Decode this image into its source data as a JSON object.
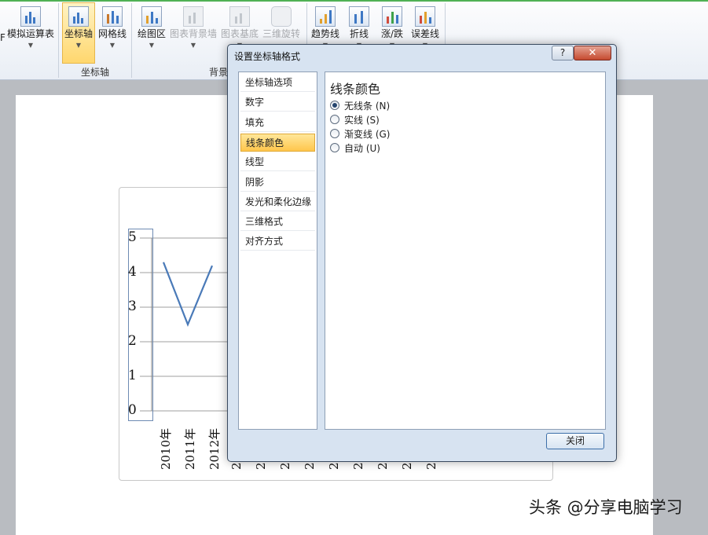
{
  "ribbon": {
    "buttons": [
      {
        "label": "模拟运算表",
        "dim": false
      },
      {
        "label": "坐标轴",
        "selected": true
      },
      {
        "label": "网格线"
      },
      {
        "label": "绘图区"
      },
      {
        "label": "图表背景墙",
        "dim": true
      },
      {
        "label": "图表基底",
        "dim": true
      },
      {
        "label": "三维旋转",
        "dim": true
      },
      {
        "label": "趋势线"
      },
      {
        "label": "折线"
      },
      {
        "label": "涨/跌"
      },
      {
        "label": "误差线"
      }
    ],
    "partial_left_label": "F",
    "group_axes": "坐标轴",
    "group_background": "背景"
  },
  "chart": {
    "y_ticks": [
      "5",
      "4",
      "3",
      "2",
      "1",
      "0"
    ],
    "x_labels": [
      "2010年",
      "2011年",
      "2012年"
    ],
    "x_labels_partial": [
      "2",
      "2",
      "2",
      "2",
      "2",
      "2",
      "2",
      "2",
      "2"
    ]
  },
  "chart_data": {
    "type": "line",
    "title": "",
    "xlabel": "",
    "ylabel": "",
    "categories": [
      "2010年",
      "2011年",
      "2012年"
    ],
    "series": [
      {
        "values": [
          4.3,
          2.5,
          4.2
        ]
      }
    ],
    "ylim": [
      0,
      5
    ],
    "grid": true,
    "line_color": "#4a7ab8"
  },
  "dialog": {
    "title": "设置坐标轴格式",
    "help": "?",
    "close_x": "✕",
    "nav_items": [
      "坐标轴选项",
      "数字",
      "填充",
      "线条颜色",
      "线型",
      "阴影",
      "发光和柔化边缘",
      "三维格式",
      "对齐方式"
    ],
    "active_index": 3,
    "section_title": "线条颜色",
    "options": [
      {
        "label": "无线条 (N)",
        "checked": true
      },
      {
        "label": "实线 (S)",
        "checked": false
      },
      {
        "label": "渐变线 (G)",
        "checked": false
      },
      {
        "label": "自动 (U)",
        "checked": false
      }
    ],
    "close_button": "关闭"
  },
  "watermark": "头条 @分享电脑学习"
}
